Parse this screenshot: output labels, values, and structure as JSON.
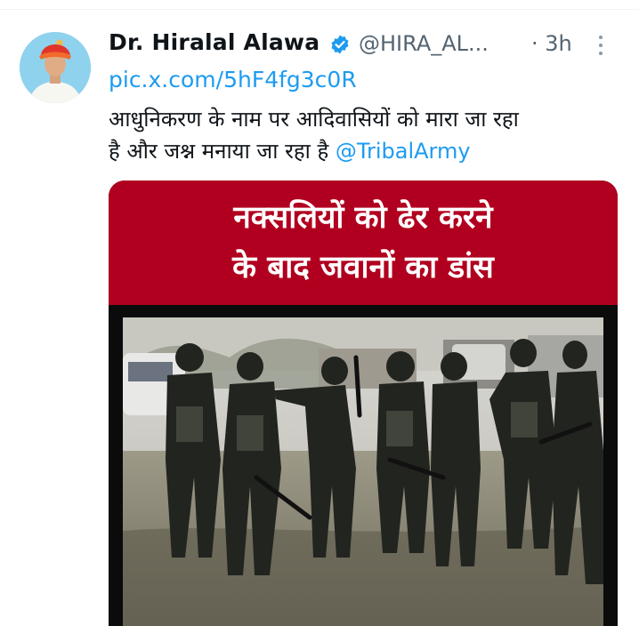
{
  "tweet": {
    "author_name": "Dr. Hiralal Alawa",
    "handle": "@HIRA_AL...",
    "time": "· 3h",
    "link": "pic.x.com/5hF4fg3c0R",
    "text_line1": "आधुनिकरण के नाम पर आदिवासियों को मारा जा रहा",
    "text_line2": "है और जश्न मनाया जा रहा है ",
    "mention": "@TribalArmy",
    "icons": {
      "verified": "verified-badge-icon",
      "more": "more-options-icon"
    },
    "colors": {
      "accent": "#1d9bf0",
      "banner": "#b1001f",
      "muted": "#536471"
    }
  },
  "media": {
    "banner_line1": "नक्सलियों को ढेर करने",
    "banner_line2": "के बाद जवानों का डांस"
  }
}
